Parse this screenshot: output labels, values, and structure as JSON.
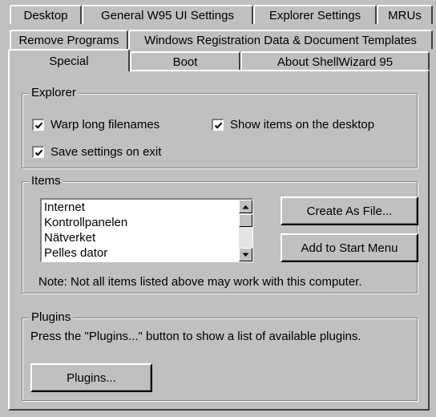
{
  "tabs": {
    "row1": [
      "Desktop",
      "General W95 UI Settings",
      "Explorer Settings",
      "MRUs"
    ],
    "row2": [
      "Remove Programs",
      "Windows Registration Data & Document Templates"
    ],
    "row3": [
      "Special",
      "Boot",
      "About ShellWizard 95"
    ],
    "selected": "Special"
  },
  "explorer_group": {
    "title": "Explorer",
    "wrap_long_filenames": {
      "label": "Warp long filenames",
      "checked": true
    },
    "show_items_on_desktop": {
      "label": "Show items on the desktop",
      "checked": true
    },
    "save_settings_on_exit": {
      "label": "Save settings on exit",
      "checked": true
    }
  },
  "items_group": {
    "title": "Items",
    "list": [
      "Internet",
      "Kontrollpanelen",
      "Nätverket",
      "Pelles dator"
    ],
    "create_as_file_button": "Create As File...",
    "add_to_start_menu_button": "Add to Start Menu",
    "note": "Note: Not all items listed above may work with this computer."
  },
  "plugins_group": {
    "title": "Plugins",
    "description": "Press the \"Plugins...\" button to show a list of available plugins.",
    "plugins_button": "Plugins..."
  },
  "icons": {
    "check": "check-mark-icon",
    "scroll_up": "arrow-up-icon",
    "scroll_down": "arrow-down-icon"
  }
}
